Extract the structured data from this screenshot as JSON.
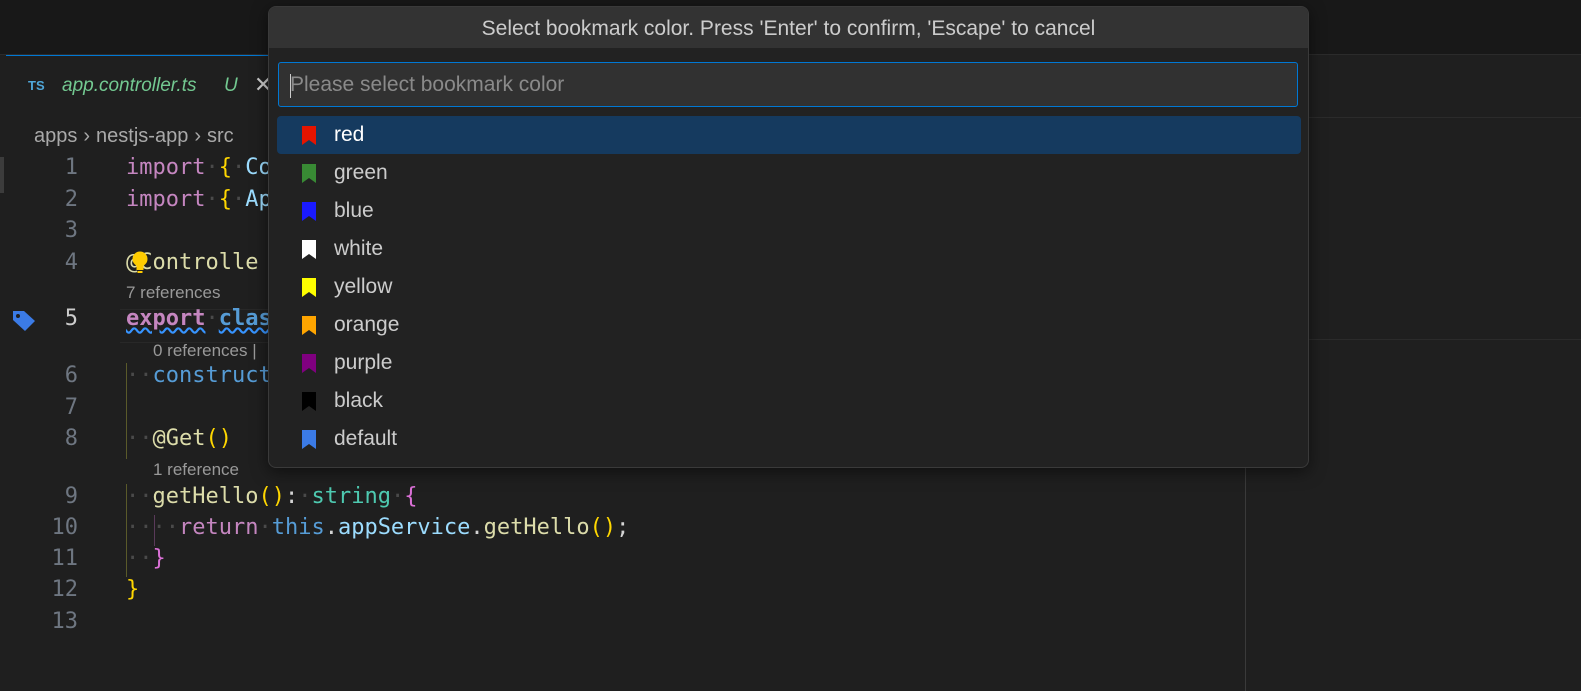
{
  "tab": {
    "lang": "TS",
    "filename": "app.controller.ts",
    "status": "U",
    "close": "✕"
  },
  "breadcrumb": {
    "items": [
      "apps",
      "nestjs-app",
      "src"
    ],
    "separator": "›"
  },
  "editor": {
    "line_numbers": [
      "1",
      "2",
      "3",
      "4",
      "5",
      "6",
      "7",
      "8",
      "9",
      "10",
      "11",
      "12",
      "13"
    ],
    "lines": {
      "l1": {
        "kw": "import",
        "brace": "{",
        "rest": "Co"
      },
      "l2": {
        "kw": "import",
        "brace": "{",
        "rest": "Ap"
      },
      "l4": {
        "text": "@Controlle"
      },
      "l5": {
        "kw": "export",
        "kw2": "clas"
      },
      "l6": {
        "text": "construct"
      },
      "l8": {
        "text": "@Get",
        "parens": "()"
      },
      "l9": {
        "fn": "getHello",
        "parens": "()",
        "colon": ":",
        "type": "string",
        "brace": "{"
      },
      "l10": {
        "kw": "return",
        "this": "this",
        "dot1": ".",
        "member": "appService",
        "dot2": ".",
        "fn": "getHello",
        "parens": "()",
        "semi": ";"
      },
      "l11": {
        "brace": "}"
      },
      "l12": {
        "brace": "}"
      }
    },
    "codelens": {
      "controller": "7 references",
      "class": "0 references |",
      "get": "1 reference"
    }
  },
  "quickpick": {
    "title": "Select bookmark color. Press 'Enter' to confirm, 'Escape' to cancel",
    "input_placeholder": "Please select bookmark color",
    "input_value": "",
    "items": [
      {
        "label": "red",
        "color": "#e51400",
        "selected": true
      },
      {
        "label": "green",
        "color": "#388a34",
        "selected": false
      },
      {
        "label": "blue",
        "color": "#1a1aff",
        "selected": false
      },
      {
        "label": "white",
        "color": "#ffffff",
        "selected": false
      },
      {
        "label": "yellow",
        "color": "#ffff00",
        "selected": false
      },
      {
        "label": "orange",
        "color": "#ffa500",
        "selected": false
      },
      {
        "label": "purple",
        "color": "#800080",
        "selected": false
      },
      {
        "label": "black",
        "color": "#000000",
        "selected": false
      },
      {
        "label": "default",
        "color": "#3b7be6",
        "selected": false
      }
    ]
  },
  "colors": {
    "accent": "#0078d4",
    "selection": "#153a5f",
    "bookmark_tag": "#3b7be6",
    "lightbulb": "#ffcc00"
  }
}
